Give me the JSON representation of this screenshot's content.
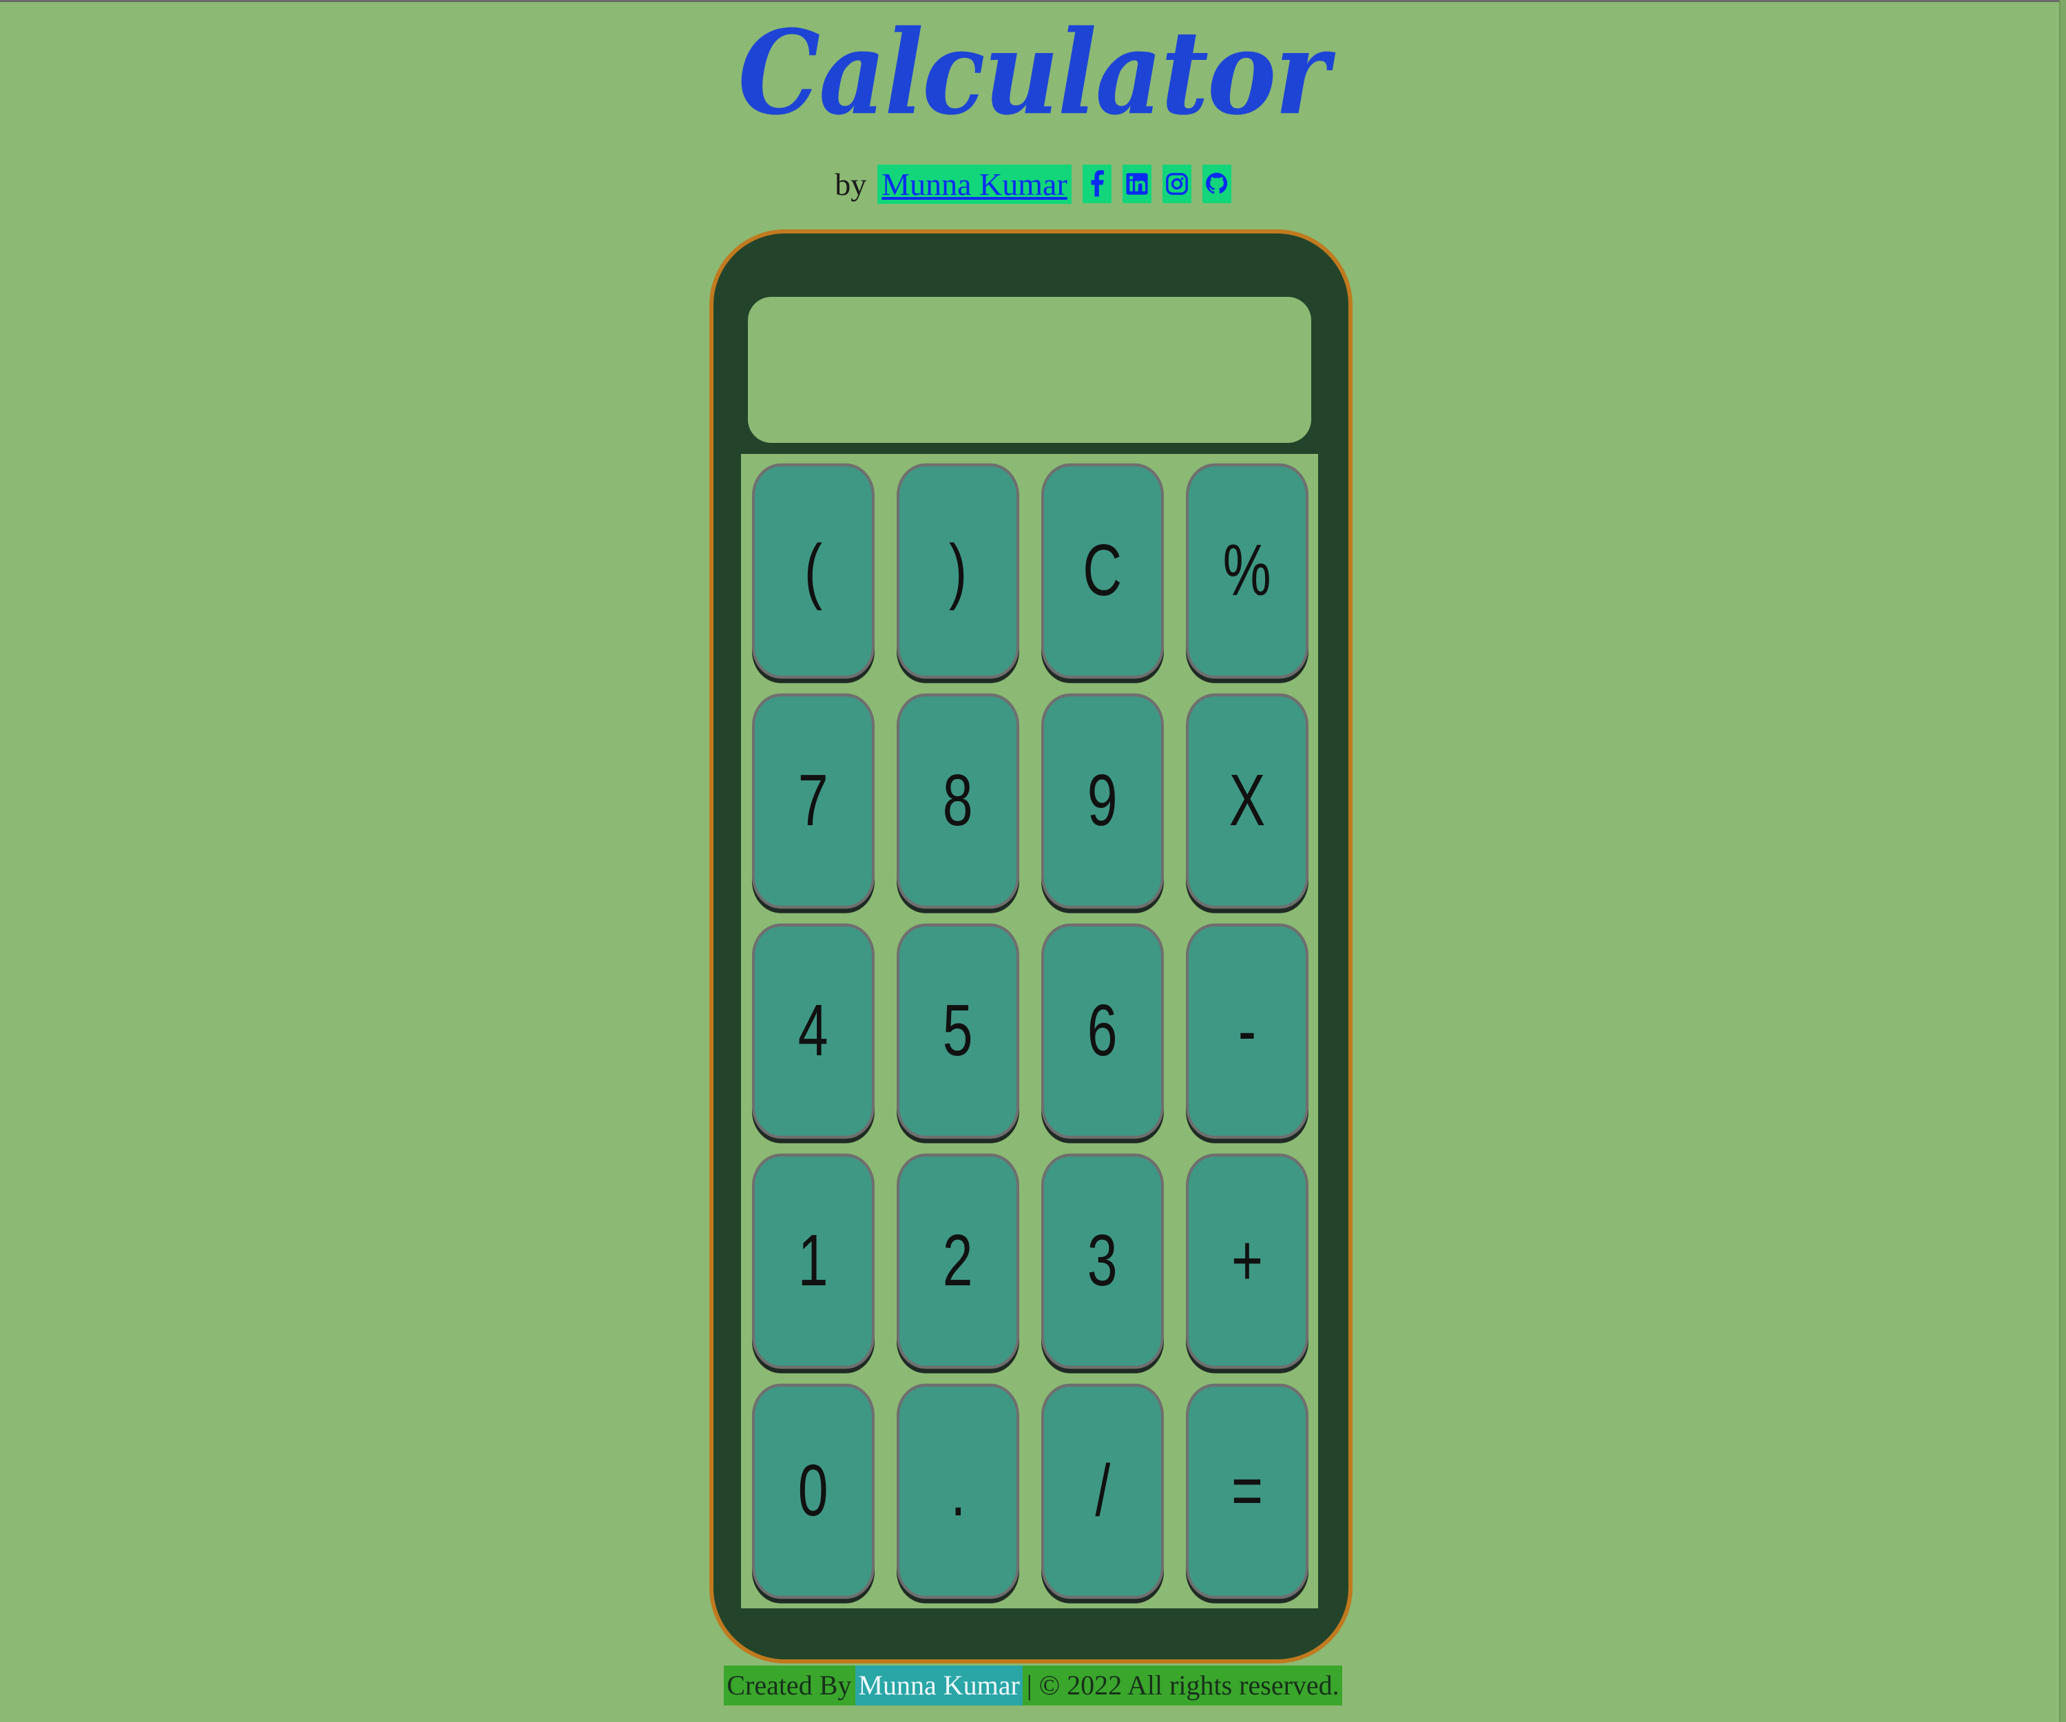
{
  "header": {
    "title": "Calculator",
    "by_label": "by",
    "author_name": "Munna Kumar",
    "social_icons": [
      "facebook-icon",
      "linkedin-icon",
      "instagram-icon",
      "github-icon"
    ]
  },
  "display": {
    "value": ""
  },
  "keys": [
    "(",
    ")",
    "C",
    "%",
    "7",
    "8",
    "9",
    "X",
    "4",
    "5",
    "6",
    "-",
    "1",
    "2",
    "3",
    "+",
    "0",
    ".",
    "/",
    "="
  ],
  "footer": {
    "created_by": "Created By",
    "author_name": "Munna Kumar",
    "rights_text": "| © 2022 All rights reserved."
  },
  "colors": {
    "background": "#8cb974",
    "calculator_body": "#23442a",
    "calculator_border": "#c07a1f",
    "key": "#3f9884",
    "title": "#1e44d6",
    "author_highlight": "#13d67a",
    "footer_bg": "#3aa62c",
    "footer_link_bg": "#2aa6a6"
  }
}
